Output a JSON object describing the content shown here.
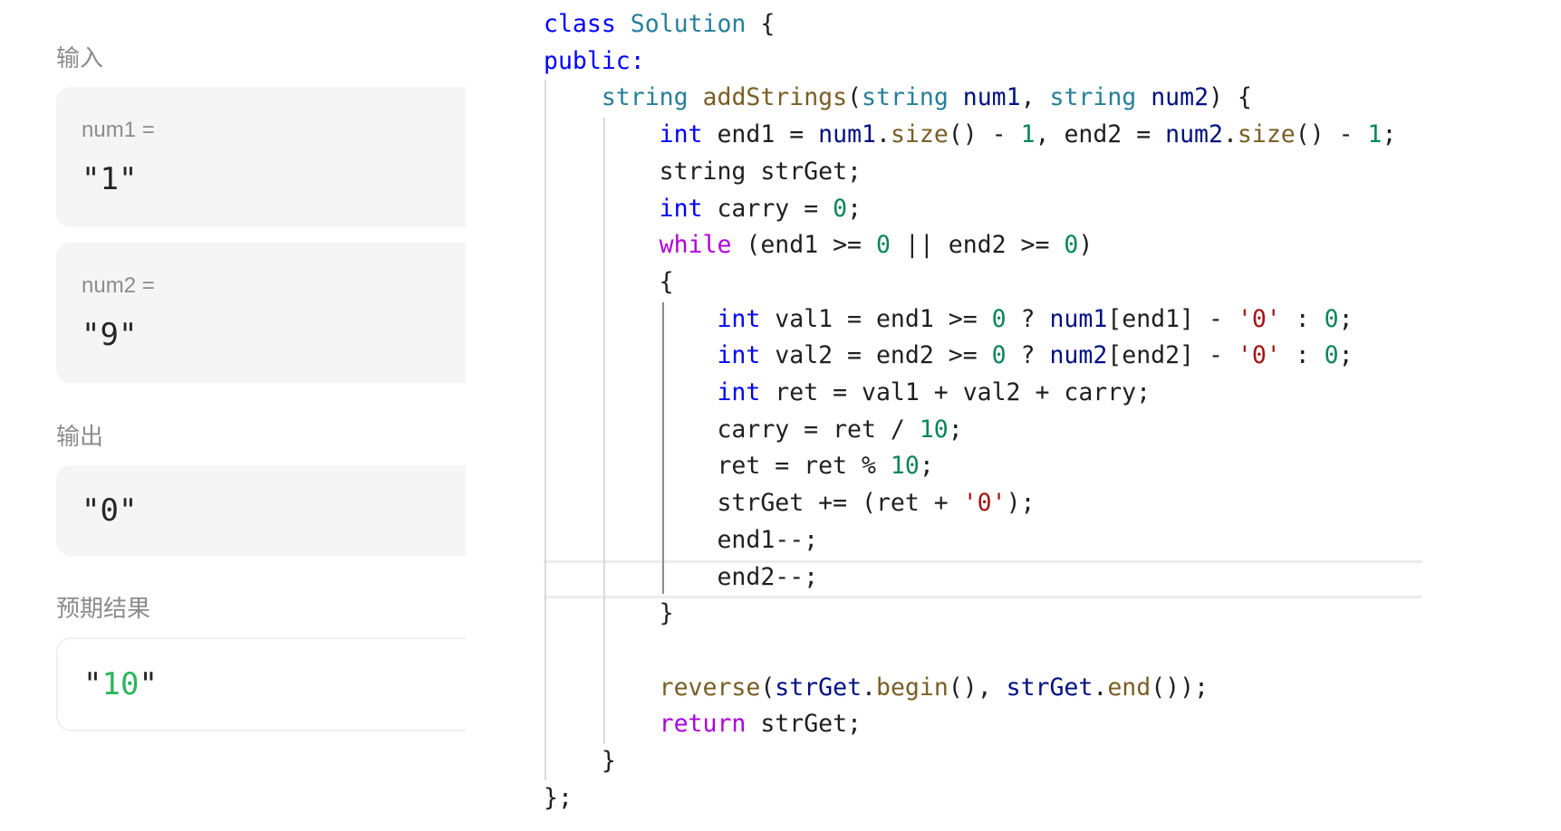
{
  "testcase": {
    "input_label": "输入",
    "inputs": [
      {
        "name": "num1 =",
        "value": "\"1\""
      },
      {
        "name": "num2 =",
        "value": "\"9\""
      }
    ],
    "output_label": "输出",
    "output_value": "\"0\"",
    "expected_label": "预期结果",
    "expected_prefix": "\"",
    "expected_diff": "10",
    "expected_suffix": "\""
  },
  "code": {
    "lines": [
      [
        {
          "t": "class",
          "c": "kw"
        },
        {
          "t": " "
        },
        {
          "t": "Solution",
          "c": "typ"
        },
        {
          "t": " {"
        }
      ],
      [
        {
          "t": "public:",
          "c": "kw"
        }
      ],
      [
        {
          "t": "    "
        },
        {
          "t": "string",
          "c": "typ"
        },
        {
          "t": " "
        },
        {
          "t": "addStrings",
          "c": "fn"
        },
        {
          "t": "("
        },
        {
          "t": "string",
          "c": "typ"
        },
        {
          "t": " "
        },
        {
          "t": "num1",
          "c": "var"
        },
        {
          "t": ", "
        },
        {
          "t": "string",
          "c": "typ"
        },
        {
          "t": " "
        },
        {
          "t": "num2",
          "c": "var"
        },
        {
          "t": ") {"
        }
      ],
      [
        {
          "t": "        "
        },
        {
          "t": "int",
          "c": "kw"
        },
        {
          "t": " end1 = "
        },
        {
          "t": "num1",
          "c": "var"
        },
        {
          "t": "."
        },
        {
          "t": "size",
          "c": "fn"
        },
        {
          "t": "() - "
        },
        {
          "t": "1",
          "c": "num"
        },
        {
          "t": ", end2 = "
        },
        {
          "t": "num2",
          "c": "var"
        },
        {
          "t": "."
        },
        {
          "t": "size",
          "c": "fn"
        },
        {
          "t": "() - "
        },
        {
          "t": "1",
          "c": "num"
        },
        {
          "t": ";"
        }
      ],
      [
        {
          "t": "        string strGet;"
        }
      ],
      [
        {
          "t": "        "
        },
        {
          "t": "int",
          "c": "kw"
        },
        {
          "t": " carry = "
        },
        {
          "t": "0",
          "c": "num"
        },
        {
          "t": ";"
        }
      ],
      [
        {
          "t": "        "
        },
        {
          "t": "while",
          "c": "kw2"
        },
        {
          "t": " (end1 >= "
        },
        {
          "t": "0",
          "c": "num"
        },
        {
          "t": " || end2 >= "
        },
        {
          "t": "0",
          "c": "num"
        },
        {
          "t": ")"
        }
      ],
      [
        {
          "t": "        {"
        }
      ],
      [
        {
          "t": "            "
        },
        {
          "t": "int",
          "c": "kw"
        },
        {
          "t": " val1 = end1 >= "
        },
        {
          "t": "0",
          "c": "num"
        },
        {
          "t": " ? "
        },
        {
          "t": "num1",
          "c": "var"
        },
        {
          "t": "[end1] - "
        },
        {
          "t": "'0'",
          "c": "str"
        },
        {
          "t": " : "
        },
        {
          "t": "0",
          "c": "num"
        },
        {
          "t": ";"
        }
      ],
      [
        {
          "t": "            "
        },
        {
          "t": "int",
          "c": "kw"
        },
        {
          "t": " val2 = end2 >= "
        },
        {
          "t": "0",
          "c": "num"
        },
        {
          "t": " ? "
        },
        {
          "t": "num2",
          "c": "var"
        },
        {
          "t": "[end2] - "
        },
        {
          "t": "'0'",
          "c": "str"
        },
        {
          "t": " : "
        },
        {
          "t": "0",
          "c": "num"
        },
        {
          "t": ";"
        }
      ],
      [
        {
          "t": "            "
        },
        {
          "t": "int",
          "c": "kw"
        },
        {
          "t": " ret = val1 + val2 + carry;"
        }
      ],
      [
        {
          "t": "            carry = ret / "
        },
        {
          "t": "10",
          "c": "num"
        },
        {
          "t": ";"
        }
      ],
      [
        {
          "t": "            ret = ret % "
        },
        {
          "t": "10",
          "c": "num"
        },
        {
          "t": ";"
        }
      ],
      [
        {
          "t": "            strGet += (ret + "
        },
        {
          "t": "'0'",
          "c": "str"
        },
        {
          "t": ");"
        }
      ],
      [
        {
          "t": "            end1--;"
        }
      ],
      [
        {
          "t": "            end2--;"
        }
      ],
      [
        {
          "t": "        }"
        }
      ],
      [
        {
          "t": ""
        }
      ],
      [
        {
          "t": "        "
        },
        {
          "t": "reverse",
          "c": "fn"
        },
        {
          "t": "("
        },
        {
          "t": "strGet",
          "c": "var"
        },
        {
          "t": "."
        },
        {
          "t": "begin",
          "c": "fn"
        },
        {
          "t": "(), "
        },
        {
          "t": "strGet",
          "c": "var"
        },
        {
          "t": "."
        },
        {
          "t": "end",
          "c": "fn"
        },
        {
          "t": "());"
        }
      ],
      [
        {
          "t": "        "
        },
        {
          "t": "return",
          "c": "kw2"
        },
        {
          "t": " strGet;"
        }
      ],
      [
        {
          "t": "    }"
        }
      ],
      [
        {
          "t": "};"
        }
      ]
    ]
  }
}
